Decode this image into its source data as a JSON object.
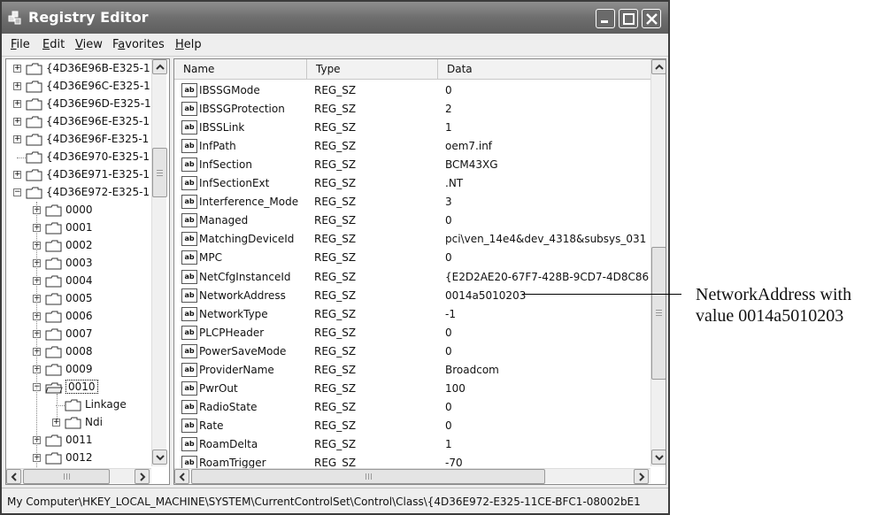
{
  "window": {
    "title": "Registry Editor"
  },
  "menu": [
    "File",
    "Edit",
    "View",
    "Favorites",
    "Help"
  ],
  "tree": [
    {
      "label": "{4D36E96B-E325-1",
      "expander": "+"
    },
    {
      "label": "{4D36E96C-E325-1",
      "expander": "+"
    },
    {
      "label": "{4D36E96D-E325-1",
      "expander": "+"
    },
    {
      "label": "{4D36E96E-E325-1",
      "expander": "+"
    },
    {
      "label": "{4D36E96F-E325-1",
      "expander": "+"
    },
    {
      "label": "{4D36E970-E325-1",
      "expander": ""
    },
    {
      "label": "{4D36E971-E325-1",
      "expander": "+"
    },
    {
      "label": "{4D36E972-E325-1",
      "expander": "-"
    },
    {
      "label": "0000",
      "expander": "+"
    },
    {
      "label": "0001",
      "expander": "+"
    },
    {
      "label": "0002",
      "expander": "+"
    },
    {
      "label": "0003",
      "expander": "+"
    },
    {
      "label": "0004",
      "expander": "+"
    },
    {
      "label": "0005",
      "expander": "+"
    },
    {
      "label": "0006",
      "expander": "+"
    },
    {
      "label": "0007",
      "expander": "+"
    },
    {
      "label": "0008",
      "expander": "+"
    },
    {
      "label": "0009",
      "expander": "+"
    },
    {
      "label": "0010",
      "expander": "-"
    },
    {
      "label": "Linkage",
      "expander": ""
    },
    {
      "label": "Ndi",
      "expander": "+"
    },
    {
      "label": "0011",
      "expander": "+"
    },
    {
      "label": "0012",
      "expander": "+"
    }
  ],
  "columns": {
    "name": "Name",
    "type": "Type",
    "data": "Data"
  },
  "values": [
    {
      "name": "IBSSGMode",
      "type": "REG_SZ",
      "data": "0"
    },
    {
      "name": "IBSSGProtection",
      "type": "REG_SZ",
      "data": "2"
    },
    {
      "name": "IBSSLink",
      "type": "REG_SZ",
      "data": "1"
    },
    {
      "name": "InfPath",
      "type": "REG_SZ",
      "data": "oem7.inf"
    },
    {
      "name": "InfSection",
      "type": "REG_SZ",
      "data": "BCM43XG"
    },
    {
      "name": "InfSectionExt",
      "type": "REG_SZ",
      "data": ".NT"
    },
    {
      "name": "Interference_Mode",
      "type": "REG_SZ",
      "data": "3"
    },
    {
      "name": "Managed",
      "type": "REG_SZ",
      "data": "0"
    },
    {
      "name": "MatchingDeviceId",
      "type": "REG_SZ",
      "data": "pci\\ven_14e4&dev_4318&subsys_031"
    },
    {
      "name": "MPC",
      "type": "REG_SZ",
      "data": "0"
    },
    {
      "name": "NetCfgInstanceId",
      "type": "REG_SZ",
      "data": "{E2D2AE20-67F7-428B-9CD7-4D8C86"
    },
    {
      "name": "NetworkAddress",
      "type": "REG_SZ",
      "data": "0014a5010203"
    },
    {
      "name": "NetworkType",
      "type": "REG_SZ",
      "data": "-1"
    },
    {
      "name": "PLCPHeader",
      "type": "REG_SZ",
      "data": "0"
    },
    {
      "name": "PowerSaveMode",
      "type": "REG_SZ",
      "data": "0"
    },
    {
      "name": "ProviderName",
      "type": "REG_SZ",
      "data": "Broadcom"
    },
    {
      "name": "PwrOut",
      "type": "REG_SZ",
      "data": "100"
    },
    {
      "name": "RadioState",
      "type": "REG_SZ",
      "data": "0"
    },
    {
      "name": "Rate",
      "type": "REG_SZ",
      "data": "0"
    },
    {
      "name": "RoamDelta",
      "type": "REG_SZ",
      "data": "1"
    },
    {
      "name": "RoamTrigger",
      "type": "REG_SZ",
      "data": "-70"
    }
  ],
  "value_icon": "ab",
  "status": "My Computer\\HKEY_LOCAL_MACHINE\\SYSTEM\\CurrentControlSet\\Control\\Class\\{4D36E972-E325-11CE-BFC1-08002bE1",
  "callout": {
    "line1": "NetworkAddress with",
    "line2": "value 0014a5010203"
  }
}
